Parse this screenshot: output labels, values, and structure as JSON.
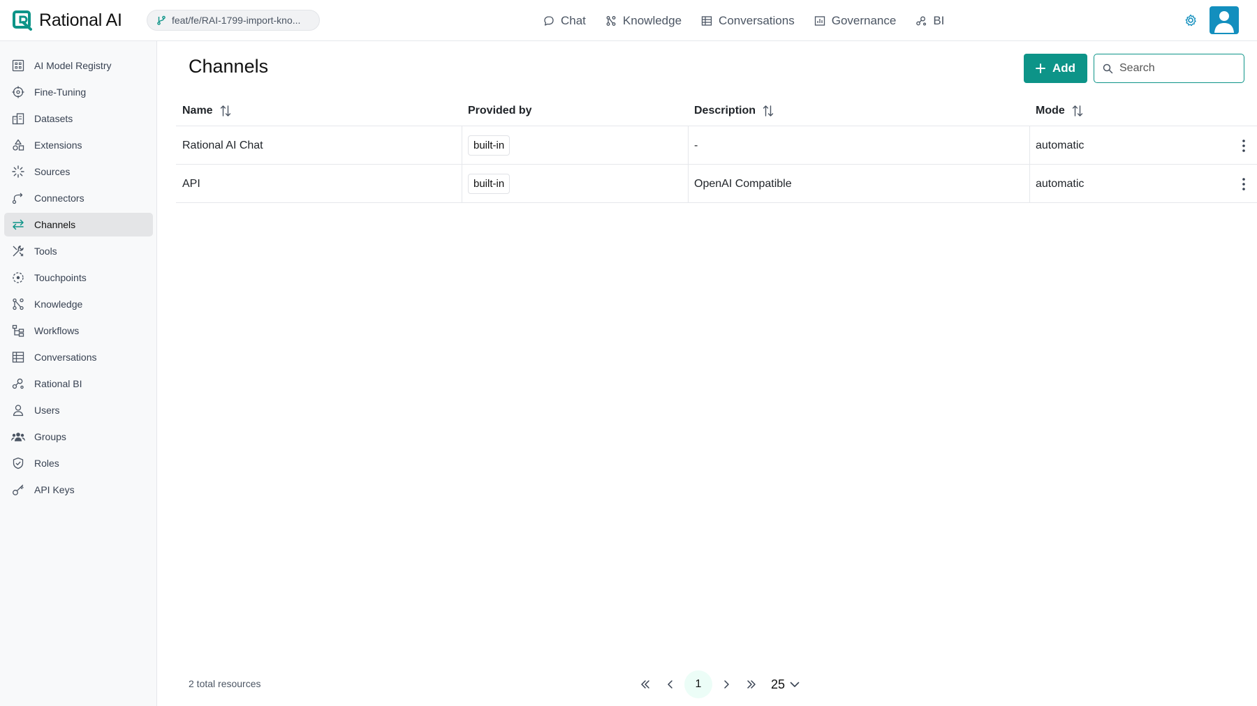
{
  "app": {
    "name": "Rational AI",
    "branch": "feat/fe/RAI-1799-import-kno..."
  },
  "topnav": [
    {
      "label": "Chat",
      "icon": "chat-bubble-icon"
    },
    {
      "label": "Knowledge",
      "icon": "knowledge-graph-icon"
    },
    {
      "label": "Conversations",
      "icon": "table-icon"
    },
    {
      "label": "Governance",
      "icon": "bar-chart-icon"
    },
    {
      "label": "BI",
      "icon": "bi-nodes-icon"
    }
  ],
  "sidebar": {
    "items": [
      {
        "label": "AI Model Registry",
        "icon": "model-registry-icon"
      },
      {
        "label": "Fine-Tuning",
        "icon": "crosshair-icon"
      },
      {
        "label": "Datasets",
        "icon": "datasets-icon"
      },
      {
        "label": "Extensions",
        "icon": "shapes-icon"
      },
      {
        "label": "Sources",
        "icon": "loader-icon"
      },
      {
        "label": "Connectors",
        "icon": "connector-icon"
      },
      {
        "label": "Channels",
        "icon": "arrows-left-right-icon",
        "active": true
      },
      {
        "label": "Tools",
        "icon": "tools-icon"
      },
      {
        "label": "Touchpoints",
        "icon": "touchpoint-icon"
      },
      {
        "label": "Knowledge",
        "icon": "knowledge-graph-icon"
      },
      {
        "label": "Workflows",
        "icon": "workflow-icon"
      },
      {
        "label": "Conversations",
        "icon": "table-icon"
      },
      {
        "label": "Rational BI",
        "icon": "bi-nodes-icon"
      },
      {
        "label": "Users",
        "icon": "user-icon"
      },
      {
        "label": "Groups",
        "icon": "users-group-icon"
      },
      {
        "label": "Roles",
        "icon": "shield-check-icon"
      },
      {
        "label": "API Keys",
        "icon": "key-icon"
      }
    ]
  },
  "main": {
    "title": "Channels",
    "add_label": "Add",
    "search_placeholder": "Search",
    "columns": [
      "Name",
      "Provided by",
      "Description",
      "Mode"
    ],
    "rows": [
      {
        "name": "Rational AI Chat",
        "provided_by": "built-in",
        "description": "-",
        "mode": "automatic"
      },
      {
        "name": "API",
        "provided_by": "built-in",
        "description": "OpenAI Compatible",
        "mode": "automatic"
      }
    ]
  },
  "footer": {
    "total": "2 total resources",
    "current_page": "1",
    "page_size": "25"
  },
  "colors": {
    "accent": "#0d9488",
    "avatar": "#138fbe",
    "active_bg": "#e4e5e7"
  }
}
